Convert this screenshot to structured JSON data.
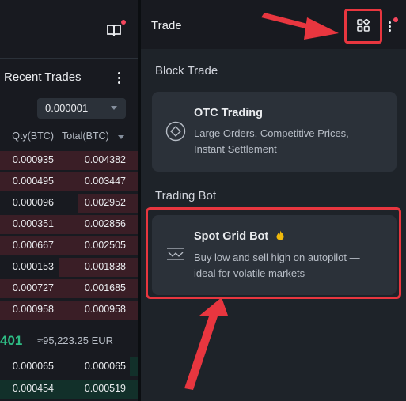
{
  "left_panel": {
    "recent_trades_title": "Recent Trades",
    "precision_value": "0.000001",
    "columns": {
      "qty": "Qty(BTC)",
      "total": "Total(BTC)"
    },
    "sell_rows": [
      {
        "qty": "0.000935",
        "total": "0.004382",
        "depth": 1.0
      },
      {
        "qty": "0.000495",
        "total": "0.003447",
        "depth": 1.0
      },
      {
        "qty": "0.000096",
        "total": "0.002952",
        "depth": 0.43
      },
      {
        "qty": "0.000351",
        "total": "0.002856",
        "depth": 1.0
      },
      {
        "qty": "0.000667",
        "total": "0.002505",
        "depth": 1.0
      },
      {
        "qty": "0.000153",
        "total": "0.001838",
        "depth": 0.57
      },
      {
        "qty": "0.000727",
        "total": "0.001685",
        "depth": 1.0
      },
      {
        "qty": "0.000958",
        "total": "0.000958",
        "depth": 1.0
      }
    ],
    "mid_price": "401",
    "mid_approx": "≈95,223.25 EUR",
    "buy_rows": [
      {
        "qty": "0.000065",
        "total": "0.000065",
        "depth": 0.06
      },
      {
        "qty": "0.000454",
        "total": "0.000519",
        "depth": 1.0
      }
    ]
  },
  "right_panel": {
    "title": "Trade",
    "block_trade_heading": "Block Trade",
    "otc": {
      "title": "OTC Trading",
      "desc_line1": "Large Orders, Competitive Prices,",
      "desc_line2": "Instant Settlement"
    },
    "trading_bot_heading": "Trading Bot",
    "spot_grid": {
      "title": "Spot Grid Bot",
      "desc_line1": "Buy low and sell high on autopilot —",
      "desc_line2": "ideal for volatile markets"
    }
  },
  "colors": {
    "accent_red": "#e8363f",
    "buy_green": "#2ebd85",
    "sell_bar": "#3a1e26",
    "buy_bar": "#12302a",
    "flame": "#f0b90b"
  },
  "icons": [
    "book-icon",
    "more-vertical-icon",
    "grid-apps-icon",
    "diamond-icon",
    "grid-bot-icon",
    "flame-icon",
    "caret-down-icon"
  ]
}
